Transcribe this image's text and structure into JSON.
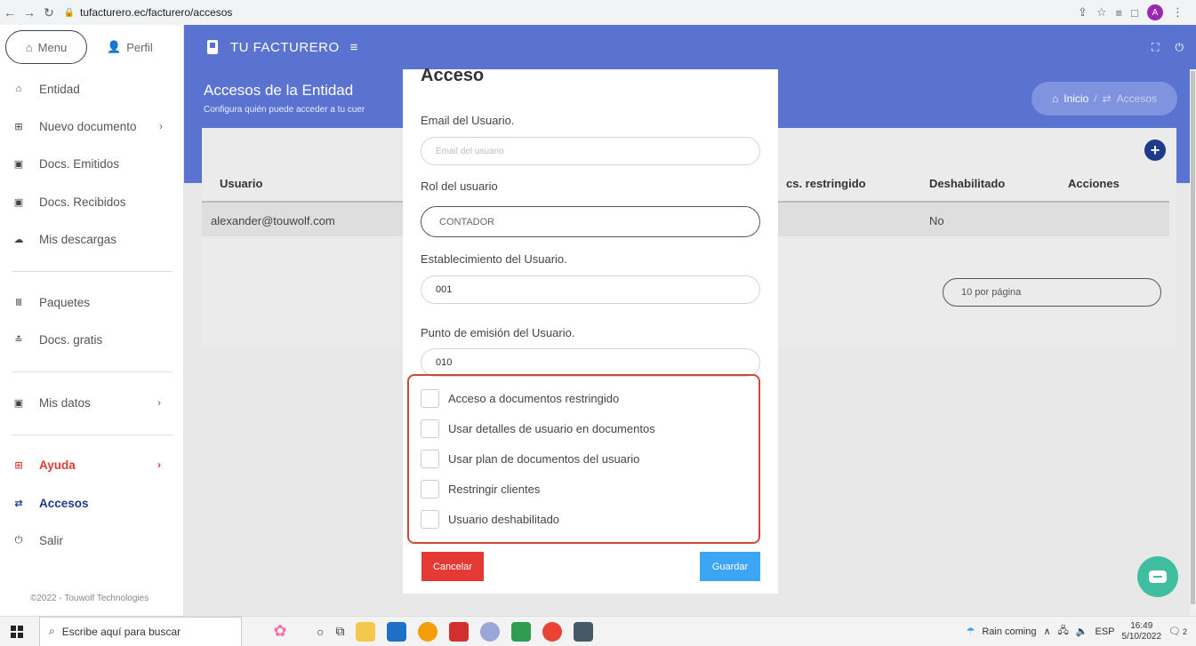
{
  "browser": {
    "url": "tufacturero.ec/facturero/accesos",
    "profile_initial": "A"
  },
  "sidebar": {
    "menu_label": "Menu",
    "profile_label": "Perfil",
    "items": [
      {
        "label": "Entidad",
        "icon": "home-icon"
      },
      {
        "label": "Nuevo documento",
        "icon": "plus-square-icon",
        "chevron": "›"
      },
      {
        "label": "Docs. Emitidos",
        "icon": "clipboard-icon"
      },
      {
        "label": "Docs. Recibidos",
        "icon": "clipboard-icon"
      },
      {
        "label": "Mis descargas",
        "icon": "cloud-download-icon"
      },
      {
        "label": "Paquetes",
        "icon": "bars-icon"
      },
      {
        "label": "Docs. gratis",
        "icon": "gift-icon"
      },
      {
        "label": "Mis datos",
        "icon": "id-card-icon",
        "chevron": "›"
      },
      {
        "label": "Ayuda",
        "icon": "plus-square-icon",
        "chevron": "›"
      },
      {
        "label": "Accesos",
        "icon": "exchange-icon"
      },
      {
        "label": "Salir",
        "icon": "power-icon"
      }
    ],
    "footer": "©2022 - Touwolf Technologies"
  },
  "header": {
    "brand": "TU FACTURERO"
  },
  "page": {
    "title": "Accesos de la Entidad",
    "subtitle": "Configura quién puede acceder a tu cuer",
    "breadcrumb_home": "Inicio",
    "breadcrumb_sep": "/",
    "breadcrumb_current": "Accesos"
  },
  "table": {
    "headers": [
      "Usuario",
      "cs. restringido",
      "Deshabilitado",
      "Acciones"
    ],
    "rows": [
      {
        "usuario": "alexander@touwolf.com",
        "deshabilitado": "No"
      }
    ],
    "per_page": "10 por página"
  },
  "modal": {
    "title": "Acceso",
    "email_label": "Email del Usuario.",
    "email_placeholder": "Email del usuario",
    "role_label": "Rol del usuario",
    "role_value": "CONTADOR",
    "establishment_label": "Establecimiento del Usuario.",
    "establishment_value": "001",
    "emission_label": "Punto de emisión del Usuario.",
    "emission_value": "010",
    "checkboxes": [
      "Acceso a documentos restringido",
      "Usar detalles de usuario en documentos",
      "Usar plan de documentos del usuario",
      "Restringir clientes",
      "Usuario deshabilitado"
    ],
    "cancel_label": "Cancelar",
    "save_label": "Guardar"
  },
  "taskbar": {
    "search_placeholder": "Escribe aquí para buscar",
    "weather": "Rain coming",
    "lang": "ESP",
    "time": "16:49",
    "date": "5/10/2022",
    "notification_count": "2"
  },
  "colors": {
    "header_blue": "#5b73d0",
    "accent_dark_blue": "#1e3a8a",
    "danger": "#e53935",
    "primary_button": "#3ca5f4",
    "highlight_border": "#c94a3c"
  }
}
